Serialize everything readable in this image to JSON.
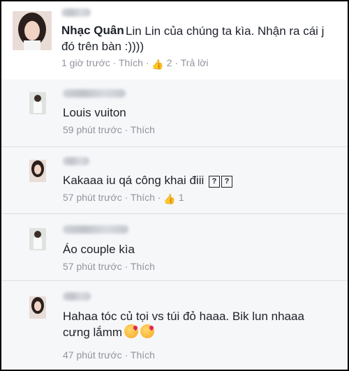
{
  "post": {
    "author": "Nhạc Quân",
    "text": "Lin Lin của chúng ta kìa. Nhận ra cái j đó trên bàn :))))",
    "time": "1 giờ trước",
    "like_label": "Thích",
    "like_count": "2",
    "reply_label": "Trả lời",
    "sep": "·"
  },
  "replies": [
    {
      "text": "Louis vuiton",
      "time": "59 phút trước",
      "like_label": "Thích",
      "like_count": ""
    },
    {
      "text": "Kakaaa iu qá công khai điii",
      "time": "57 phút trước",
      "like_label": "Thích",
      "like_count": "1",
      "icons": [
        "?",
        "?"
      ]
    },
    {
      "text": "Áo couple kìa",
      "time": "57 phút trước",
      "like_label": "Thích",
      "like_count": ""
    },
    {
      "text_line1": "Hahaa tóc củ tọi vs túi đỏ haaa. Bik lun nhaaa",
      "text_line2": "cưng lắmm",
      "time": "47 phút trước",
      "like_label": "Thích",
      "like_count": ""
    }
  ],
  "icons": {
    "like": "thumbs-up-icon",
    "unknown_char": "question-box-icon",
    "kiss": "kiss-emoji-icon"
  }
}
